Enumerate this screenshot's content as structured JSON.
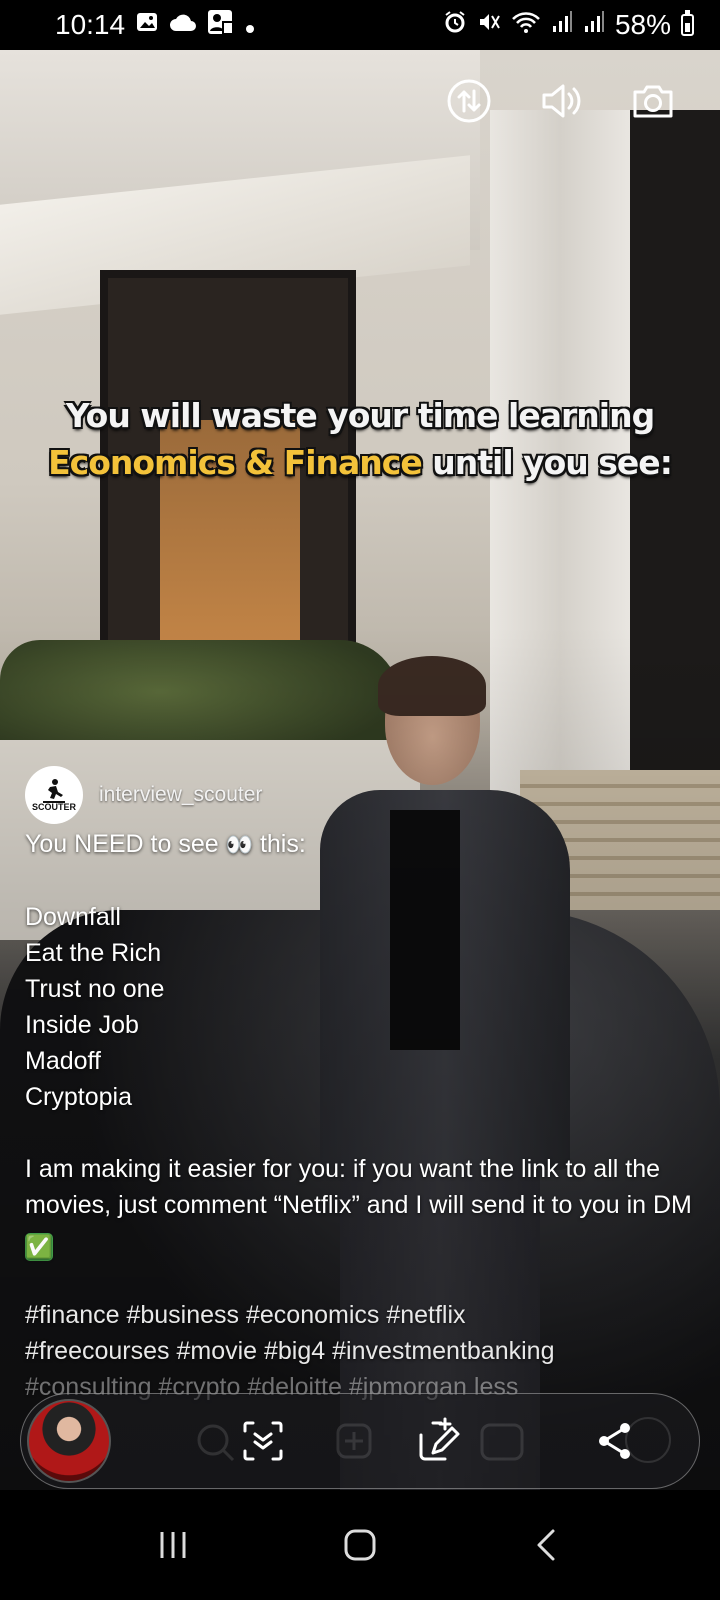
{
  "status_bar": {
    "time": "10:14",
    "battery": "58%",
    "left_icons": [
      "gallery-icon",
      "cloud-icon",
      "profile-card-icon",
      "dot-icon"
    ],
    "right_icons": [
      "alarm-icon",
      "mute-icon",
      "wifi-icon",
      "signal-icon",
      "signal-icon",
      "battery-icon"
    ]
  },
  "video_controls": {
    "icons": [
      "data-saver-icon",
      "volume-icon",
      "camera-icon"
    ]
  },
  "overlay": {
    "line1": "You will waste your time learning",
    "line2_highlight": "Economics & Finance",
    "line2_rest": "until you see:"
  },
  "post": {
    "avatar_text": "SCOUTER",
    "username": "interview_scouter",
    "intro_before": "You NEED to see",
    "intro_emoji": "👀",
    "intro_after": "this:",
    "movies": [
      "Downfall",
      "Eat the Rich",
      "Trust no one",
      "Inside Job",
      "Madoff",
      "Cryptopia"
    ],
    "cta_text": "I am making it easier for you: if you want the link to all the movies, just comment “Netflix” and I will send it to you in DM",
    "cta_emoji": "✅",
    "hashtags_line1": "#finance #business #economics #netflix",
    "hashtags_line2": "#freecourses #movie #big4 #investmentbanking",
    "hashtags_line3": "#consulting #crypto #deloitte #jpmorgan",
    "more_label": "less"
  },
  "toolbar": {
    "icons": [
      "smart-select-icon",
      "screen-write-icon",
      "share-icon"
    ]
  },
  "nav_bar": {
    "icons": [
      "recent-apps-icon",
      "home-icon",
      "back-icon"
    ]
  }
}
